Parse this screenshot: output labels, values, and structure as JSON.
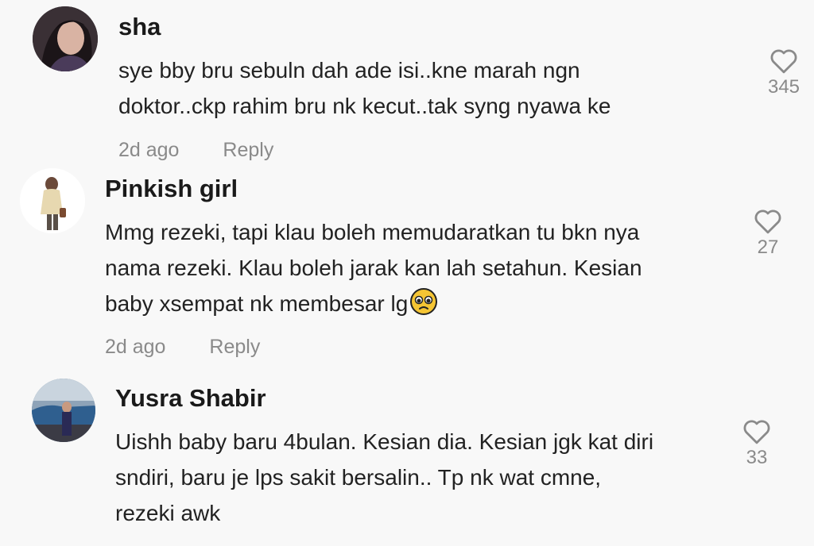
{
  "comments": [
    {
      "username": "sha",
      "line1": "sye bby bru sebuln dah ade isi..kne marah ngn",
      "line2": "doktor..ckp rahim bru nk kecut..tak syng nyawa ke",
      "time": "2d ago",
      "reply": "Reply",
      "likes": "345"
    },
    {
      "username": "Pinkish girl",
      "line1": "Mmg rezeki, tapi klau boleh memudaratkan tu bkn nya",
      "line2": "nama rezeki. Klau boleh jarak kan lah setahun. Kesian",
      "line3": "baby xsempat nk membesar lg",
      "time": "2d ago",
      "reply": "Reply",
      "likes": "27"
    },
    {
      "username": "Yusra Shabir",
      "line1": "Uishh baby baru 4bulan. Kesian dia. Kesian jgk kat diri",
      "line2": "sndiri, baru je lps sakit bersalin.. Tp nk wat cmne,",
      "line3": "rezeki awk",
      "likes": "33"
    }
  ],
  "icons": {
    "like": "heart-outline-icon",
    "emoji": "pleading-face-emoji"
  },
  "colors": {
    "background": "#f8f8f8",
    "meta": "#8a8a8a"
  }
}
